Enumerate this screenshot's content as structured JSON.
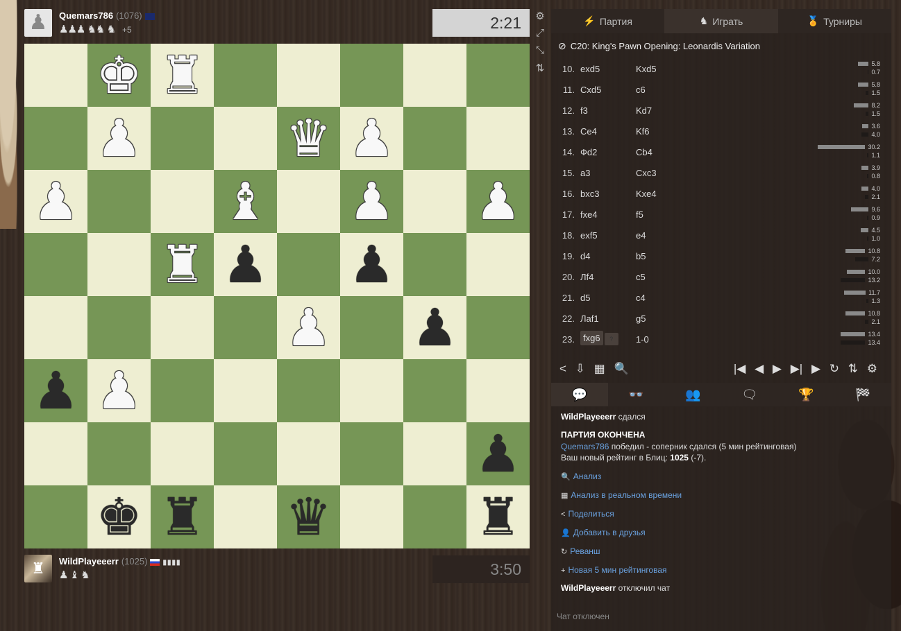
{
  "top_player": {
    "name": "Quemars786",
    "rating": "(1076)",
    "captured": "♟♟♟ ♞♞ ♞",
    "advantage": "+5",
    "clock": "2:21"
  },
  "bottom_player": {
    "name": "WildPlayeeerr",
    "rating": "(1025)",
    "captured": "♟ ♝ ♞",
    "clock": "3:50"
  },
  "side_icons": [
    "⚙",
    "⤢",
    "⤡",
    "⇅"
  ],
  "board": {
    "rows": [
      [
        "",
        "wK",
        "wR",
        "",
        "",
        "",
        "",
        ""
      ],
      [
        "",
        "wP",
        "",
        "",
        "wQ",
        "wP",
        "",
        ""
      ],
      [
        "wP",
        "",
        "",
        "wB",
        "",
        "wP",
        "",
        "wP"
      ],
      [
        "",
        "",
        "wR",
        "bP",
        "",
        "bP",
        "",
        ""
      ],
      [
        "",
        "",
        "",
        "",
        "wP",
        "",
        "bP",
        ""
      ],
      [
        "bP",
        "wP",
        "",
        "",
        "",
        "",
        "",
        ""
      ],
      [
        "",
        "",
        "",
        "",
        "",
        "",
        "",
        "bP"
      ],
      [
        "",
        "bK",
        "bR",
        "",
        "bQ",
        "",
        "",
        "bR"
      ]
    ]
  },
  "tabs": [
    {
      "label": "Партия",
      "icon": "⚡"
    },
    {
      "label": "Играть",
      "icon": "♞"
    },
    {
      "label": "Турниры",
      "icon": "🏅"
    }
  ],
  "opening": "C20: King's Pawn Opening: Leonardis Variation",
  "moves": [
    {
      "num": "10.",
      "white": "exd5",
      "black": "Kxd5",
      "ew": 5.8,
      "eb": 0.7,
      "ewl": "5.8",
      "ebl": "0.7"
    },
    {
      "num": "11.",
      "white": "Cxd5",
      "black": "c6",
      "ew": 5.8,
      "eb": 1.5,
      "ewl": "5.8",
      "ebl": "1.5"
    },
    {
      "num": "12.",
      "white": "f3",
      "black": "Kd7",
      "ew": 8.2,
      "eb": 1.5,
      "ewl": "8.2",
      "ebl": "1.5"
    },
    {
      "num": "13.",
      "white": "Ce4",
      "black": "Kf6",
      "ew": 3.6,
      "eb": 4.0,
      "ewl": "3.6",
      "ebl": "4.0"
    },
    {
      "num": "14.",
      "white": "Фd2",
      "black": "Cb4",
      "ew": 30.2,
      "eb": 1.1,
      "ewl": "30.2",
      "ebl": "1.1"
    },
    {
      "num": "15.",
      "white": "a3",
      "black": "Cxc3",
      "ew": 3.9,
      "eb": 0.8,
      "ewl": "3.9",
      "ebl": "0.8"
    },
    {
      "num": "16.",
      "white": "bxc3",
      "black": "Kxe4",
      "ew": 4.0,
      "eb": 2.1,
      "ewl": "4.0",
      "ebl": "2.1"
    },
    {
      "num": "17.",
      "white": "fxe4",
      "black": "f5",
      "ew": 9.6,
      "eb": 0.9,
      "ewl": "9.6",
      "ebl": "0.9"
    },
    {
      "num": "18.",
      "white": "exf5",
      "black": "e4",
      "ew": 4.5,
      "eb": 1.0,
      "ewl": "4.5",
      "ebl": "1.0"
    },
    {
      "num": "19.",
      "white": "d4",
      "black": "b5",
      "ew": 10.8,
      "eb": 7.2,
      "ewl": "10.8",
      "ebl": "7.2"
    },
    {
      "num": "20.",
      "white": "Лf4",
      "black": "c5",
      "ew": 10.0,
      "eb": 13.2,
      "ewl": "10.0",
      "ebl": "13.2"
    },
    {
      "num": "21.",
      "white": "d5",
      "black": "c4",
      "ew": 11.7,
      "eb": 1.3,
      "ewl": "11.7",
      "ebl": "1.3"
    },
    {
      "num": "22.",
      "white": "Лаf1",
      "black": "g5",
      "ew": 10.8,
      "eb": 2.1,
      "ewl": "10.8",
      "ebl": "2.1"
    },
    {
      "num": "23.",
      "white": "fxg6",
      "black": "1-0",
      "ew": 13.4,
      "eb": 13.4,
      "ewl": "13.4",
      "ebl": "13.4"
    }
  ],
  "controls_left": [
    "<",
    "⇩",
    "▦",
    "🔍"
  ],
  "controls_right": [
    "|◀",
    "◀",
    "▶",
    "▶|",
    "▶",
    "↻",
    "⇅",
    "⚙"
  ],
  "chat_tabs": [
    "💬",
    "👓",
    "👥",
    "🗨",
    "🏆",
    "🏁"
  ],
  "chat": {
    "resigned_user": "WildPlayeeerr",
    "resigned_text": "сдался",
    "game_over": "ПАРТИЯ ОКОНЧЕНА",
    "winner": "Quemars786",
    "winner_text": "победил - соперник сдался (5 мин рейтинговая)",
    "rating_text": "Ваш новый рейтинг в Блиц:",
    "new_rating": "1025",
    "rating_change": "(-7).",
    "actions": [
      {
        "icon": "🔍",
        "label": "Анализ"
      },
      {
        "icon": "▦",
        "label": "Анализ в реальном времени"
      },
      {
        "icon": "<",
        "label": "Поделиться"
      },
      {
        "icon": "👤",
        "label": "Добавить в друзья"
      },
      {
        "icon": "↻",
        "label": "Реванш"
      },
      {
        "icon": "+",
        "label": "Новая 5 мин рейтинговая"
      }
    ],
    "disabled_user": "WildPlayeeerr",
    "disabled_text": "отключил чат",
    "input_placeholder": "Чат отключен"
  },
  "colors": {
    "light_square": "#eeeed2",
    "dark_square": "#769656",
    "link": "#6aa2e0"
  }
}
